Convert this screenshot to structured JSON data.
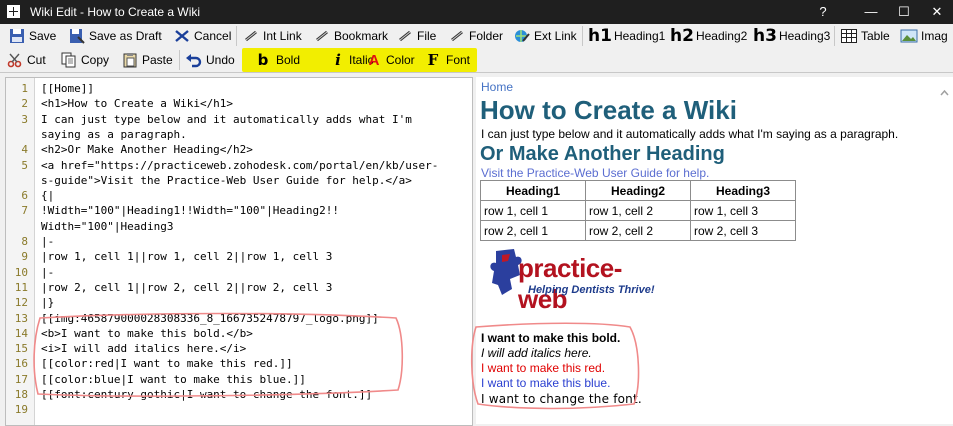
{
  "window": {
    "title": "Wiki Edit - How to Create a Wiki",
    "help": "?",
    "minimize": "—",
    "maximize": "☐",
    "close": "✕"
  },
  "toolbar1": {
    "save": "Save",
    "save_as_draft": "Save as Draft",
    "cancel": "Cancel",
    "int_link": "Int Link",
    "bookmark": "Bookmark",
    "file": "File",
    "folder": "Folder",
    "ext_link": "Ext Link",
    "heading1": "Heading1",
    "heading2": "Heading2",
    "heading3": "Heading3",
    "h1_glyph": "h1",
    "h2_glyph": "h2",
    "h3_glyph": "h3",
    "table": "Table",
    "image": "Imag"
  },
  "toolbar2": {
    "cut": "Cut",
    "copy": "Copy",
    "paste": "Paste",
    "undo": "Undo",
    "bold": "Bold",
    "italic": "Italic",
    "color": "Color",
    "font": "Font",
    "bold_glyph": "b",
    "italic_glyph": "i",
    "color_glyph": "A",
    "font_glyph": "F"
  },
  "editor": {
    "lines": [
      {
        "n": "1",
        "text": "[[Home]]"
      },
      {
        "n": "2",
        "text": "<h1>How to Create a Wiki</h1>"
      },
      {
        "n": "3",
        "text": "I can just type below and it automatically adds what I'm"
      },
      {
        "n": "",
        "text": "saying as a paragraph."
      },
      {
        "n": "4",
        "text": "<h2>Or Make Another Heading</h2>"
      },
      {
        "n": "5",
        "text": "<a href=\"https://practiceweb.zohodesk.com/portal/en/kb/user-"
      },
      {
        "n": "",
        "text": "s-guide\">Visit the Practice-Web User Guide for help.</a>"
      },
      {
        "n": "6",
        "text": "{|"
      },
      {
        "n": "7",
        "text": "!Width=\"100\"|Heading1!!Width=\"100\"|Heading2!!"
      },
      {
        "n": "",
        "text": "Width=\"100\"|Heading3"
      },
      {
        "n": "8",
        "text": "|-"
      },
      {
        "n": "9",
        "text": "|row 1, cell 1||row 1, cell 2||row 1, cell 3"
      },
      {
        "n": "10",
        "text": "|-"
      },
      {
        "n": "11",
        "text": "|row 2, cell 1||row 2, cell 2||row 2, cell 3"
      },
      {
        "n": "12",
        "text": "|}"
      },
      {
        "n": "13",
        "text": "[[img:465879000028308336_8_1667352478797_logo.png]]"
      },
      {
        "n": "14",
        "text": "<b>I want to make this bold.</b>"
      },
      {
        "n": "15",
        "text": "<i>I will add italics here.</i>"
      },
      {
        "n": "16",
        "text": "[[color:red|I want to make this red.]]"
      },
      {
        "n": "17",
        "text": "[[color:blue|I want to make this blue.]]"
      },
      {
        "n": "18",
        "text": "[[font:century gothic|I want to change the font.]]"
      },
      {
        "n": "19",
        "text": ""
      }
    ]
  },
  "preview": {
    "home_link": "Home",
    "h1": "How to Create a Wiki",
    "paragraph": "I can just type below and it automatically adds what I'm saying as a paragraph.",
    "h2": "Or Make Another Heading",
    "link": "Visit the Practice-Web User Guide for help.",
    "table": {
      "headers": [
        "Heading1",
        "Heading2",
        "Heading3"
      ],
      "rows": [
        [
          "row 1, cell 1",
          "row 1, cell 2",
          "row 1, cell 3"
        ],
        [
          "row 2, cell 1",
          "row 2, cell 2",
          "row 2, cell 3"
        ]
      ]
    },
    "logo": {
      "name": "practice-web",
      "tagline": "Helping Dentists Thrive!"
    },
    "bold_line": "I want to make this bold.",
    "italic_line": "I will add italics here.",
    "red_line": "I want to make this red.",
    "blue_line": "I want to make this blue.",
    "font_line": "I want to change the font."
  },
  "colors": {
    "highlight": "#f2ee00",
    "annotation": "#f08a8a",
    "heading": "#1f5f7a",
    "red": "#e00000",
    "blue": "#2a3fd0"
  }
}
